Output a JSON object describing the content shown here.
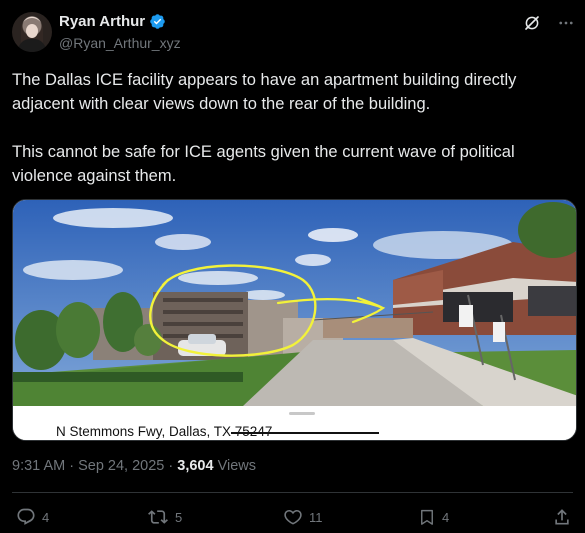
{
  "author": {
    "display_name": "Ryan Arthur",
    "handle": "@Ryan_Arthur_xyz",
    "verified": true
  },
  "header_icons": [
    "grok-icon",
    "more-icon"
  ],
  "tweet": {
    "paragraphs": [
      "The Dallas ICE facility appears to have an apartment building directly adjacent with clear views down to the rear of the building.",
      "This cannot be safe for ICE agents given the current wave of political violence against them."
    ]
  },
  "media": {
    "address_text": "N Stemmons Fwy, Dallas, TX 75247"
  },
  "meta": {
    "timestamp": "9:31 AM · Sep 24, 2025 · ",
    "views_count": "3,604",
    "views_label": " Views"
  },
  "actions": {
    "reply_count": "4",
    "repost_count": "5",
    "like_count": "11",
    "bookmark_count": "4"
  },
  "colors": {
    "background": "#000000",
    "text_primary": "#e7e9ea",
    "text_secondary": "#71767b",
    "verified_blue": "#1d9bf0",
    "annotation_yellow": "#f2f23a"
  }
}
